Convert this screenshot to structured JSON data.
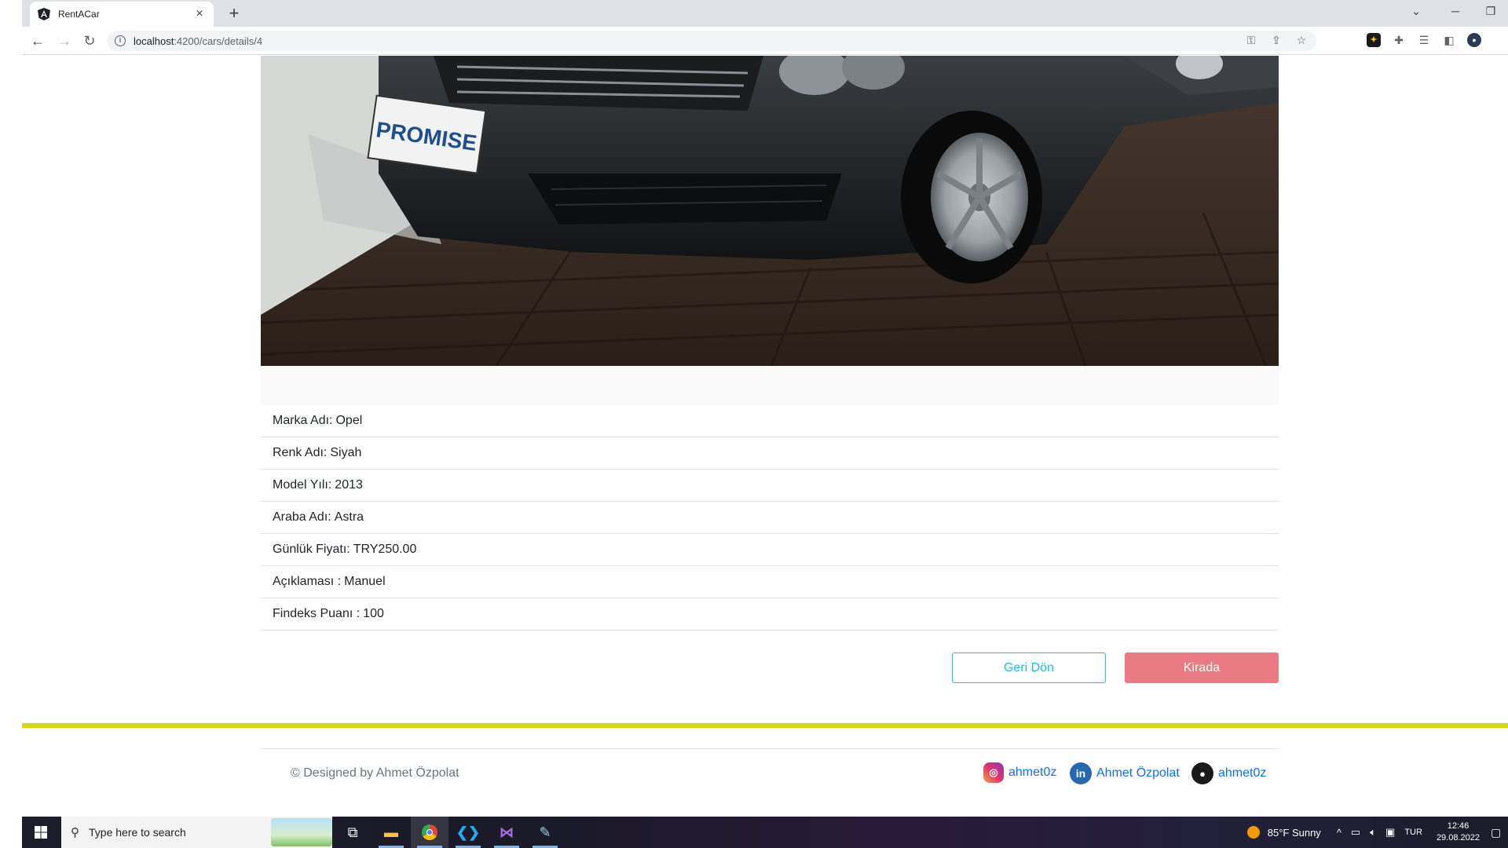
{
  "browser": {
    "tab_title": "RentACar",
    "url_host": "localhost",
    "url_path": ":4200/cars/details/4"
  },
  "car_photo": {
    "plate_text": "PROMISE"
  },
  "details": [
    {
      "label": "Marka Adı:",
      "value": "Opel"
    },
    {
      "label": "Renk Adı:",
      "value": "Siyah"
    },
    {
      "label": "Model Yılı:",
      "value": "2013"
    },
    {
      "label": "Araba Adı:",
      "value": "Astra"
    },
    {
      "label": "Günlük Fiyatı:",
      "value": "TRY250.00"
    },
    {
      "label": "Açıklaması :",
      "value": "Manuel"
    },
    {
      "label": "Findeks Puanı :",
      "value": "100"
    }
  ],
  "buttons": {
    "back": "Geri Dön",
    "rent": "Kirada"
  },
  "footer": {
    "copyright": "© Designed by Ahmet Özpolat",
    "instagram": "ahmet0z",
    "linkedin": "Ahmet Özpolat",
    "github": "ahmet0z"
  },
  "taskbar": {
    "search_placeholder": "Type here to search",
    "weather": "85°F  Sunny",
    "language": "TUR",
    "time": "12:46",
    "date": "29.08.2022"
  },
  "colors": {
    "accent_cyan": "#17c1e8",
    "rent_button": "#ea7b85",
    "divider_yellow": "#d8d80a"
  }
}
